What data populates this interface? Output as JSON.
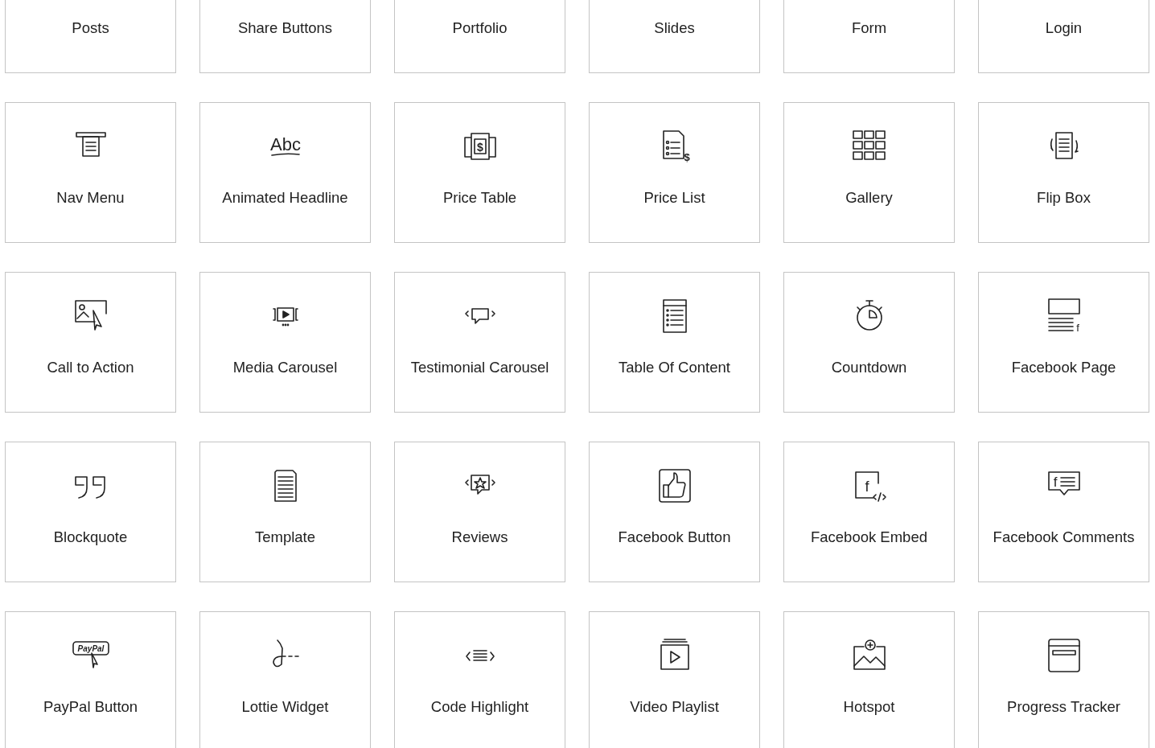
{
  "tiles": [
    {
      "label": "Posts"
    },
    {
      "label": "Share Buttons"
    },
    {
      "label": "Portfolio"
    },
    {
      "label": "Slides"
    },
    {
      "label": "Form"
    },
    {
      "label": "Login"
    },
    {
      "label": "Nav Menu"
    },
    {
      "label": "Animated Headline",
      "glyph": "Abc"
    },
    {
      "label": "Price Table",
      "glyph": "$"
    },
    {
      "label": "Price List",
      "glyph": "$"
    },
    {
      "label": "Gallery"
    },
    {
      "label": "Flip Box"
    },
    {
      "label": "Call to Action"
    },
    {
      "label": "Media Carousel"
    },
    {
      "label": "Testimonial Carousel"
    },
    {
      "label": "Table Of Content"
    },
    {
      "label": "Countdown"
    },
    {
      "label": "Facebook Page",
      "glyph": "f"
    },
    {
      "label": "Blockquote"
    },
    {
      "label": "Template"
    },
    {
      "label": "Reviews"
    },
    {
      "label": "Facebook Button"
    },
    {
      "label": "Facebook Embed",
      "glyph": "f"
    },
    {
      "label": "Facebook Comments",
      "glyph": "f"
    },
    {
      "label": "PayPal Button",
      "glyph": "PayPal"
    },
    {
      "label": "Lottie Widget"
    },
    {
      "label": "Code Highlight"
    },
    {
      "label": "Video Playlist"
    },
    {
      "label": "Hotspot"
    },
    {
      "label": "Progress Tracker"
    }
  ]
}
